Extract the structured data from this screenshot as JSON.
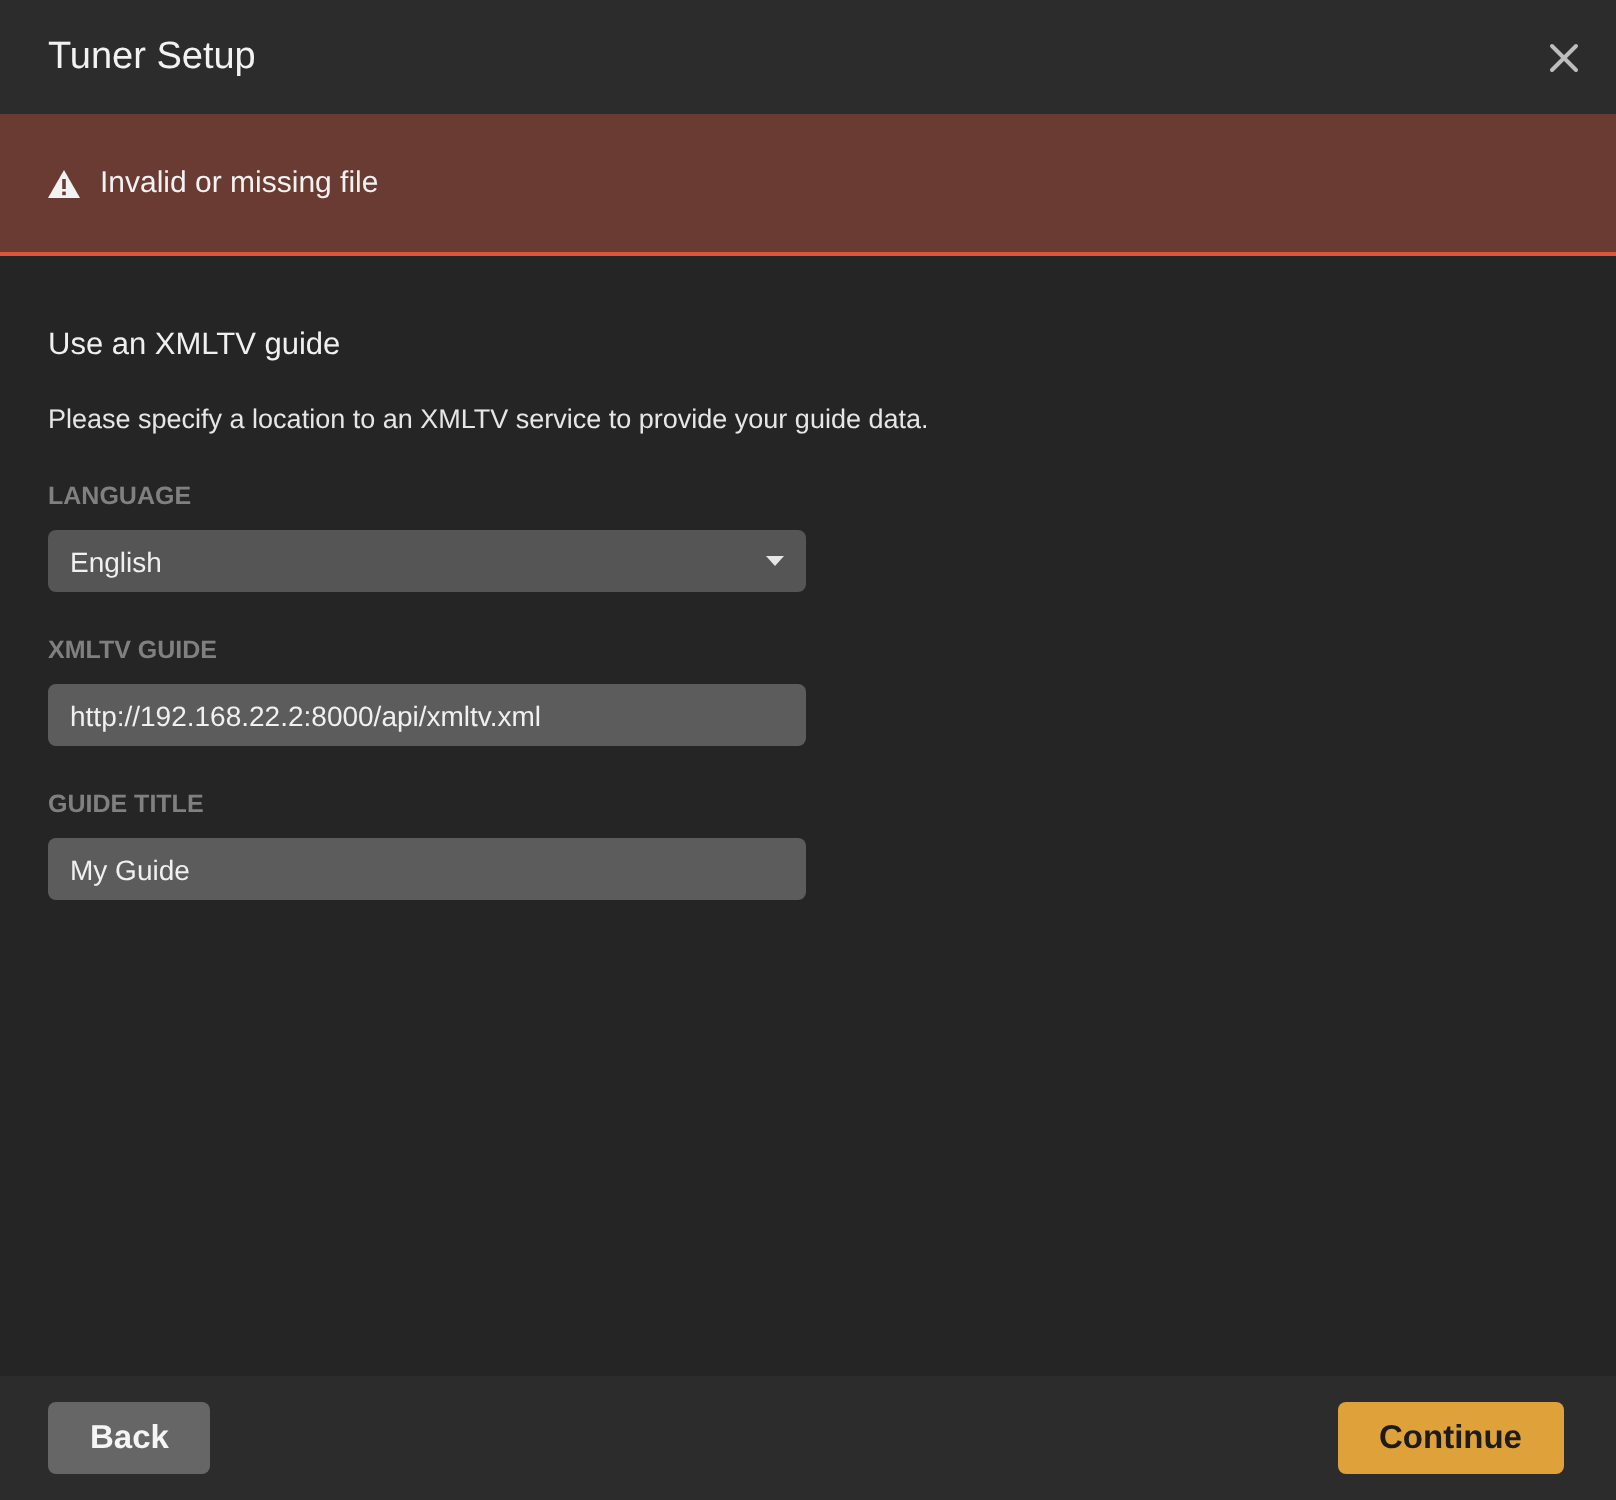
{
  "dialog": {
    "title": "Tuner Setup"
  },
  "alert": {
    "kind": "error",
    "message": "Invalid or missing file"
  },
  "section": {
    "heading": "Use an XMLTV guide",
    "description": "Please specify a location to an XMLTV service to provide your guide data."
  },
  "fields": [
    {
      "kind": "select",
      "label": "LANGUAGE",
      "value": "English"
    },
    {
      "kind": "text",
      "label": "XMLTV GUIDE",
      "value": "http://192.168.22.2:8000/api/xmltv.xml"
    },
    {
      "kind": "text",
      "label": "GUIDE TITLE",
      "value": "My Guide"
    }
  ],
  "buttons": [
    {
      "kind": "secondary",
      "label": "Back"
    },
    {
      "kind": "primary",
      "label": "Continue"
    }
  ]
}
